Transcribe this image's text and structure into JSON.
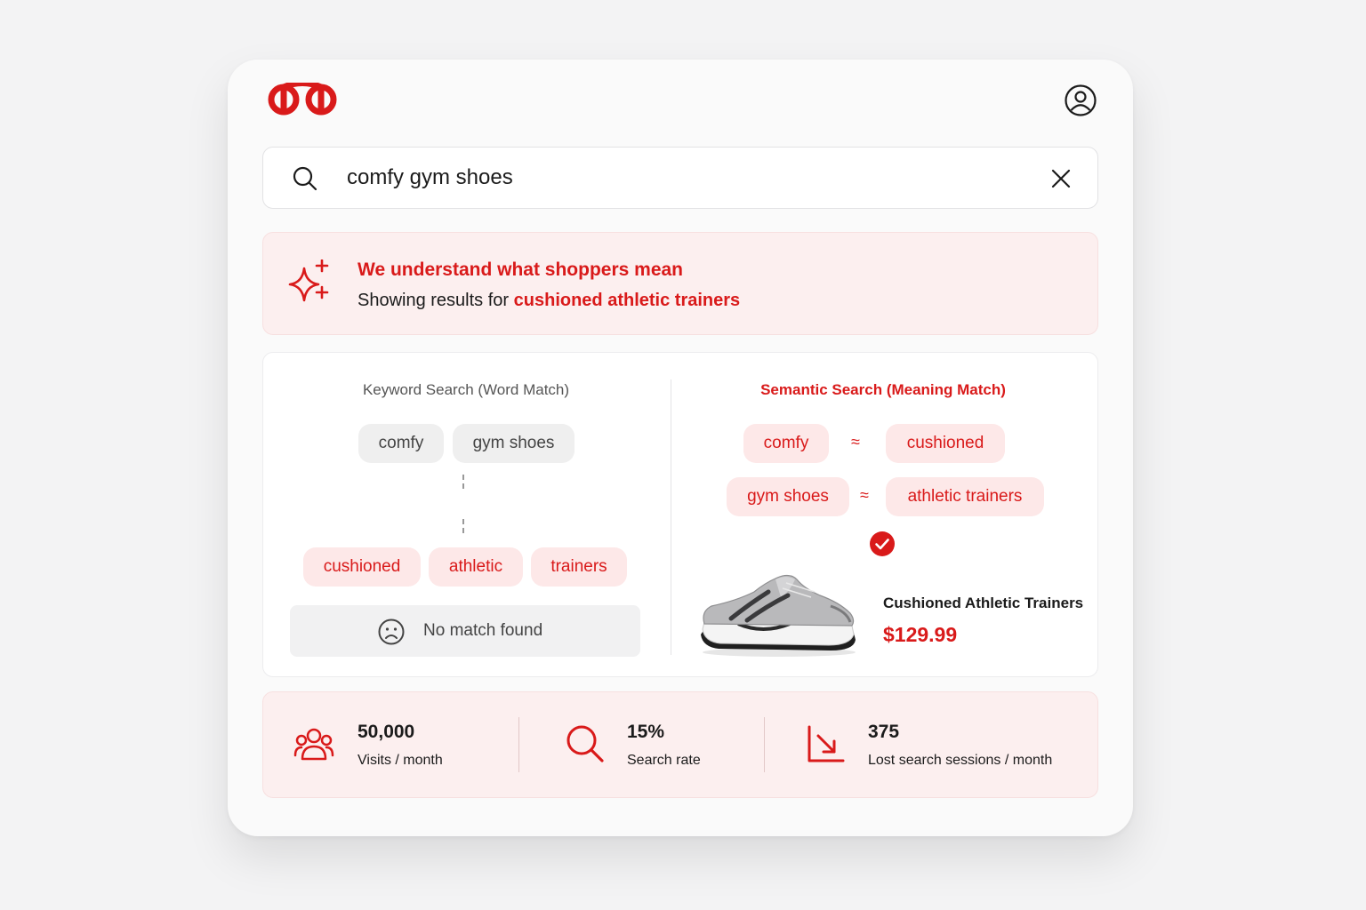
{
  "brand": {
    "accent": "#d91a1a",
    "logo_icon": "brand-logo-icon"
  },
  "header": {
    "avatar_icon": "user-account-icon"
  },
  "search": {
    "query": "comfy gym shoes",
    "icon": "search-icon",
    "clear_icon": "close-icon"
  },
  "banner": {
    "icon": "sparkle-icon",
    "title": "We understand what shoppers mean",
    "subtitle_prefix": "Showing results for ",
    "subtitle_highlight": "cushioned athletic trainers"
  },
  "keyword_search": {
    "title": "Keyword Search (Word Match)",
    "query_terms": [
      "comfy",
      "gym shoes"
    ],
    "product_terms": [
      "cushioned",
      "athletic",
      "trainers"
    ],
    "result": "No match found",
    "result_icon": "sad-face-icon"
  },
  "semantic_search": {
    "title": "Semantic Search (Meaning Match)",
    "mappings": [
      {
        "from": "comfy",
        "symbol": "≈",
        "to": "cushioned"
      },
      {
        "from": "gym shoes",
        "symbol": "≈",
        "to": "athletic trainers"
      }
    ],
    "match_icon": "check-circle-icon",
    "product": {
      "name": "Cushioned Athletic Trainers",
      "price": "$129.99",
      "image": "running-shoe-image"
    }
  },
  "stats": [
    {
      "icon": "users-icon",
      "value": "50,000",
      "label": "Visits / month"
    },
    {
      "icon": "search-icon",
      "value": "15%",
      "label": "Search rate"
    },
    {
      "icon": "trend-down-icon",
      "value": "375",
      "label": "Lost search sessions / month"
    }
  ]
}
